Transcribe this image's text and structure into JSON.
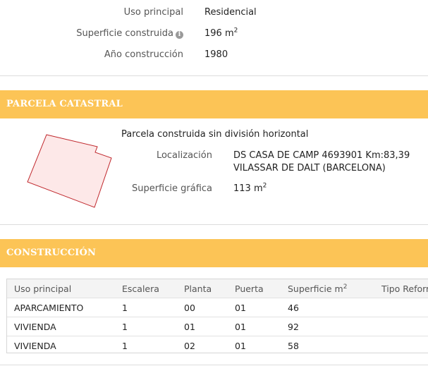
{
  "building": {
    "uso_principal_label": "Uso principal",
    "uso_principal_value": "Residencial",
    "superficie_label": "Superficie construida",
    "superficie_value": "196 m",
    "superficie_unit_sup": "2",
    "anio_label": "Año construcción",
    "anio_value": "1980"
  },
  "parcela": {
    "header": "PARCELA CATASTRAL",
    "description": "Parcela construida sin división horizontal",
    "localizacion_label": "Localización",
    "localizacion_line1": "DS CASA DE CAMP 4693901 Km:83,39",
    "localizacion_line2": "VILASSAR DE DALT (BARCELONA)",
    "superficie_grafica_label": "Superficie gráfica",
    "superficie_grafica_value": "113 m",
    "superficie_grafica_sup": "2"
  },
  "construccion": {
    "header": "CONSTRUCCIÓN",
    "columns": [
      "Uso principal",
      "Escalera",
      "Planta",
      "Puerta",
      "Superficie m",
      "Tipo Reform"
    ],
    "superficie_col_sup": "2",
    "rows": [
      {
        "uso": "APARCAMIENTO",
        "escalera": "1",
        "planta": "00",
        "puerta": "01",
        "superficie": "46",
        "tipo": ""
      },
      {
        "uso": "VIVIENDA",
        "escalera": "1",
        "planta": "01",
        "puerta": "01",
        "superficie": "92",
        "tipo": ""
      },
      {
        "uso": "VIVIENDA",
        "escalera": "1",
        "planta": "02",
        "puerta": "01",
        "superficie": "58",
        "tipo": ""
      }
    ]
  },
  "colors": {
    "band": "#fcc456",
    "parcel_fill": "#fde8e8",
    "parcel_stroke": "#c0282d"
  },
  "icons": {
    "info": "info-circle-icon"
  }
}
